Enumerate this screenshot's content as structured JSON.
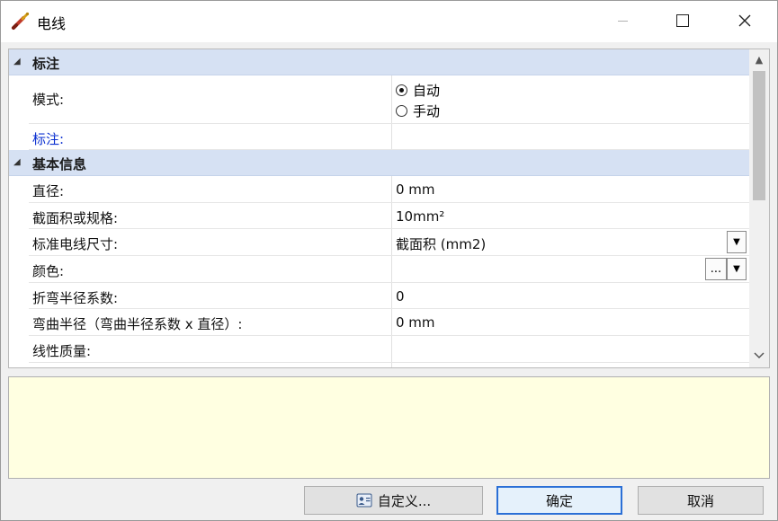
{
  "window": {
    "title": "电线"
  },
  "grid": {
    "categories": [
      {
        "label": "标注"
      },
      {
        "label": "基本信息"
      }
    ],
    "annotation": {
      "mode_label": "模式:",
      "mode_options": [
        "自动",
        "手动"
      ],
      "mode_selected": "自动",
      "annotation_label": "标注:",
      "annotation_value": ""
    },
    "basic": [
      {
        "label": "直径:",
        "value": "0 mm"
      },
      {
        "label": "截面积或规格:",
        "value": "10mm²"
      },
      {
        "label": "标准电线尺寸:",
        "value": "截面积 (mm2)"
      },
      {
        "label": "颜色:",
        "value": ""
      },
      {
        "label": "折弯半径系数:",
        "value": "0"
      },
      {
        "label": "弯曲半径（弯曲半径系数 x 直径）:",
        "value": "0 mm"
      },
      {
        "label": "线性质量:",
        "value": ""
      }
    ],
    "ellipsis": "..."
  },
  "buttons": {
    "custom": "自定义...",
    "ok": "确定",
    "cancel": "取消"
  },
  "icons": {
    "app": "wire-icon",
    "minimize": "minimize-icon",
    "maximize": "maximize-icon",
    "close": "close-icon",
    "collapse": "collapse-triangle-icon",
    "dropdown": "chevron-down-icon",
    "custom": "contact-card-icon"
  }
}
